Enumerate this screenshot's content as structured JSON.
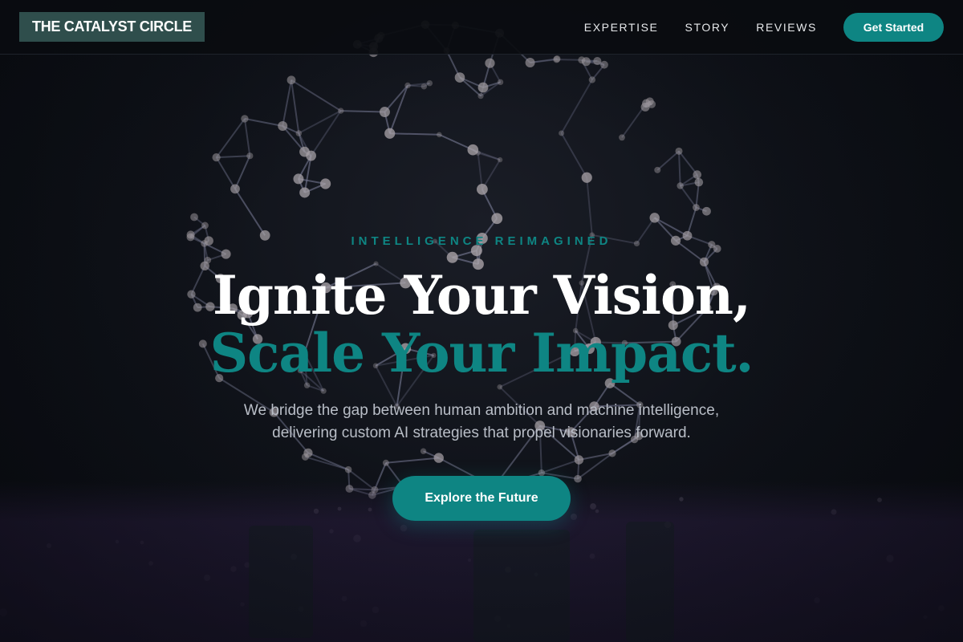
{
  "nav": {
    "logo": "THE CATALYST CIRCLE",
    "links": [
      "EXPERTISE",
      "STORY",
      "REVIEWS"
    ],
    "cta": "Get Started"
  },
  "hero": {
    "eyebrow": "INTELLIGENCE REIMAGINED",
    "headline_line1": "Ignite Your Vision,",
    "headline_line2": "Scale Your Impact.",
    "subtext_line1": "We bridge the gap between human ambition and machine intelligence,",
    "subtext_line2": "delivering custom AI strategies that propel visionaries forward.",
    "cta": "Explore the Future"
  },
  "colors": {
    "accent": "#0e8583",
    "logo_bg": "#2f4e4c",
    "background": "#0b0d12",
    "subtext": "#b9bec7"
  },
  "background_image": "network-sphere-illustration"
}
